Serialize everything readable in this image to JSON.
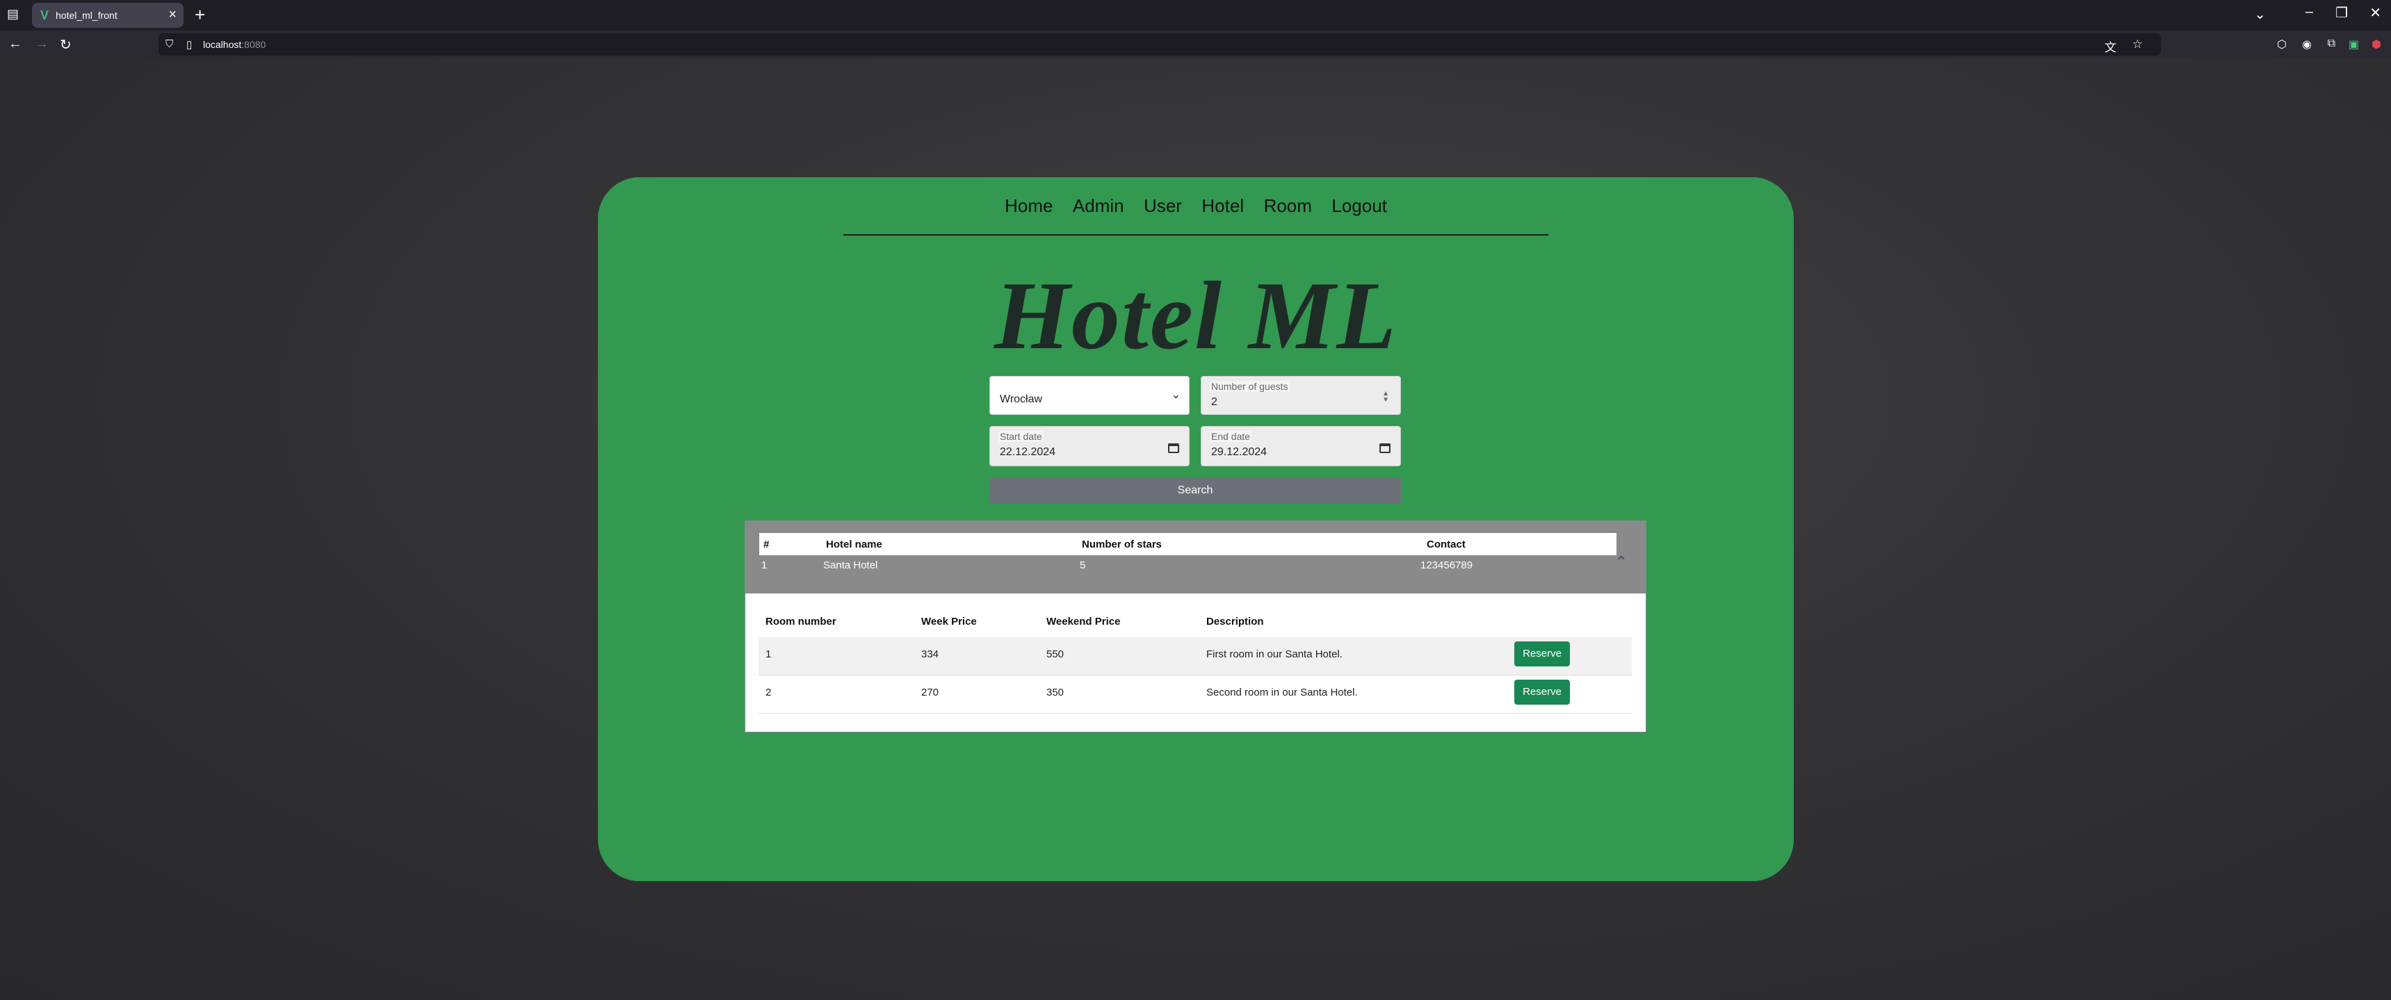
{
  "browser": {
    "tab_title": "hotel_ml_front",
    "url_host": "localhost",
    "url_port": ":8080"
  },
  "nav": [
    "Home",
    "Admin",
    "User",
    "Hotel",
    "Room",
    "Logout"
  ],
  "brand": "Hotel ML",
  "search": {
    "city": "Wrocław",
    "guests_label": "Number of guests",
    "guests_value": "2",
    "start_label": "Start date",
    "start_value": "22.12.2024",
    "end_label": "End date",
    "end_value": "29.12.2024",
    "button": "Search"
  },
  "hotels": {
    "headers": [
      "#",
      "Hotel name",
      "Number of stars",
      "Contact"
    ],
    "row": [
      "1",
      "Santa Hotel",
      "5",
      "123456789"
    ]
  },
  "rooms": {
    "headers": [
      "Room number",
      "Week Price",
      "Weekend Price",
      "Description"
    ],
    "rows": [
      {
        "number": "1",
        "week": "334",
        "weekend": "550",
        "description": "First room in our Santa Hotel.",
        "action": "Reserve"
      },
      {
        "number": "2",
        "week": "270",
        "weekend": "350",
        "description": "Second room in our Santa Hotel.",
        "action": "Reserve"
      }
    ]
  },
  "colors": {
    "card": "#339850",
    "reserve": "#198754",
    "search_button": "#6e7079"
  }
}
